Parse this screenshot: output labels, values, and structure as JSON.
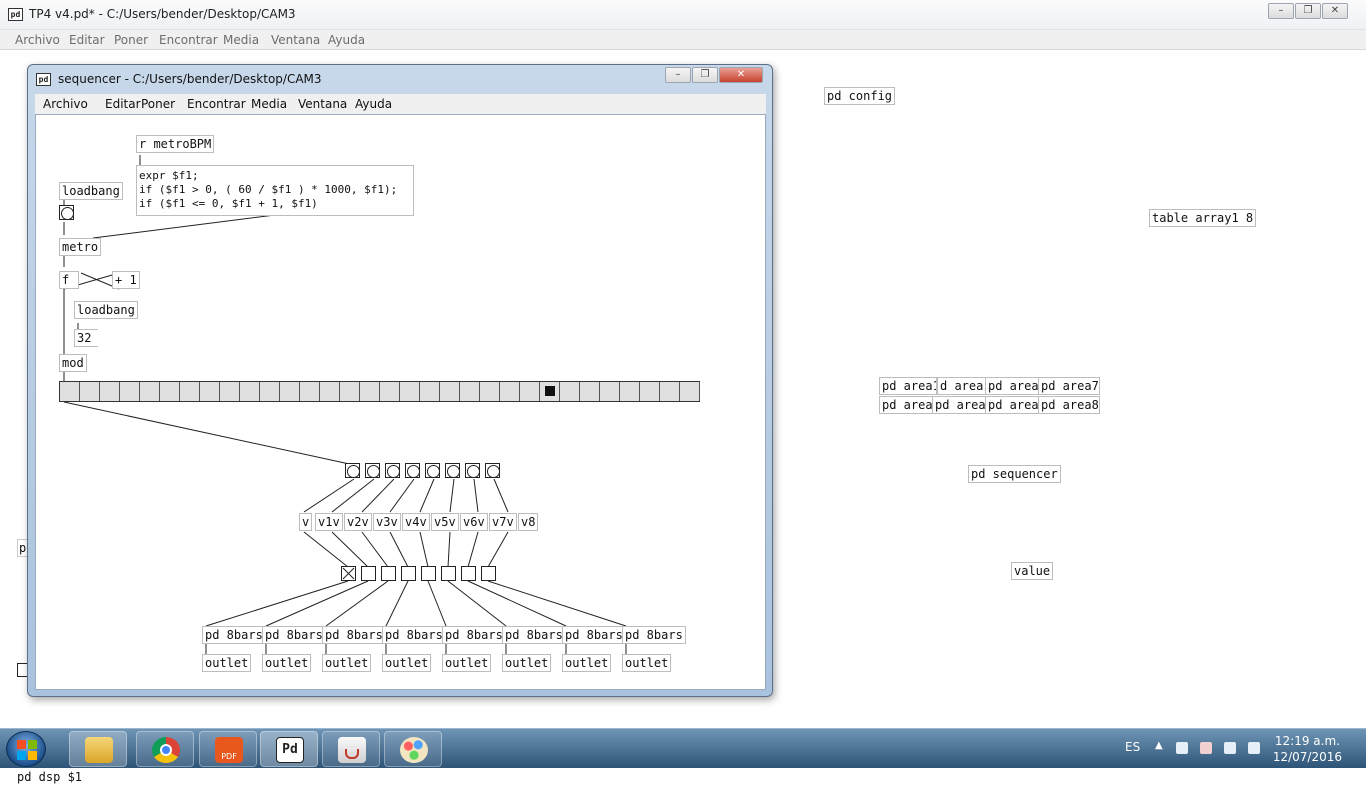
{
  "main_window": {
    "title": "TP4 v4.pd* - C:/Users/bender/Desktop/CAM3",
    "menu": [
      "Archivo",
      "Editar",
      "Poner",
      "Encontrar",
      "Media",
      "Ventana",
      "Ayuda"
    ],
    "objects": {
      "pd_config": "pd config",
      "table_array1": "table array1 8",
      "area1": "pd area1",
      "area3": "d area",
      "area5": "pd area",
      "area7": "pd area7",
      "area2": "pd area",
      "area4": "pd area",
      "area6": "pd area",
      "area8": "pd area8",
      "pd_sequencer": "pd sequencer",
      "value": "value",
      "left_partial": "p",
      "semicolon": ";",
      "pd_dsp": "pd dsp $1"
    }
  },
  "sequencer_window": {
    "title": "sequencer  - C:/Users/bender/Desktop/CAM3",
    "menu": [
      "Archivo",
      "Editar",
      "Poner",
      "Encontrar",
      "Media",
      "Ventana",
      "Ayuda"
    ],
    "objects": {
      "r_metro": "r metroBPM",
      "expr": "expr $f1;\nif ($f1 > 0, ( 60 / $f1 ) * 1000, $f1);\nif ($f1 <= 0, $f1 + 1, $f1)",
      "loadbang1": "loadbang",
      "metro": "metro",
      "f": "f",
      "plus1": "+ 1",
      "loadbang2": "loadbang",
      "num32": "32",
      "mod": "mod",
      "v_row": [
        "v",
        "v1v",
        "v2v",
        "v3v",
        "v4v",
        "v5v",
        "v6v",
        "v7v",
        "v8"
      ],
      "pd_8bars": "pd 8bars",
      "outlet": "outlet"
    },
    "radio": {
      "cells": 32,
      "selected": 24
    }
  },
  "taskbar": {
    "language": "ES",
    "time": "12:19 a.m.",
    "date": "12/07/2016",
    "apps": [
      "explorer-icon",
      "chrome-icon",
      "pdf-icon",
      "puredata-icon",
      "java-icon",
      "paint-icon"
    ],
    "pd_label": "Pd",
    "pdf_label": "PDF"
  },
  "colors": {
    "title_bg": "#eef1f5",
    "seq_frame": "#a9c2dd",
    "taskbar": "#3a6184",
    "close_button": "#c7422f"
  }
}
